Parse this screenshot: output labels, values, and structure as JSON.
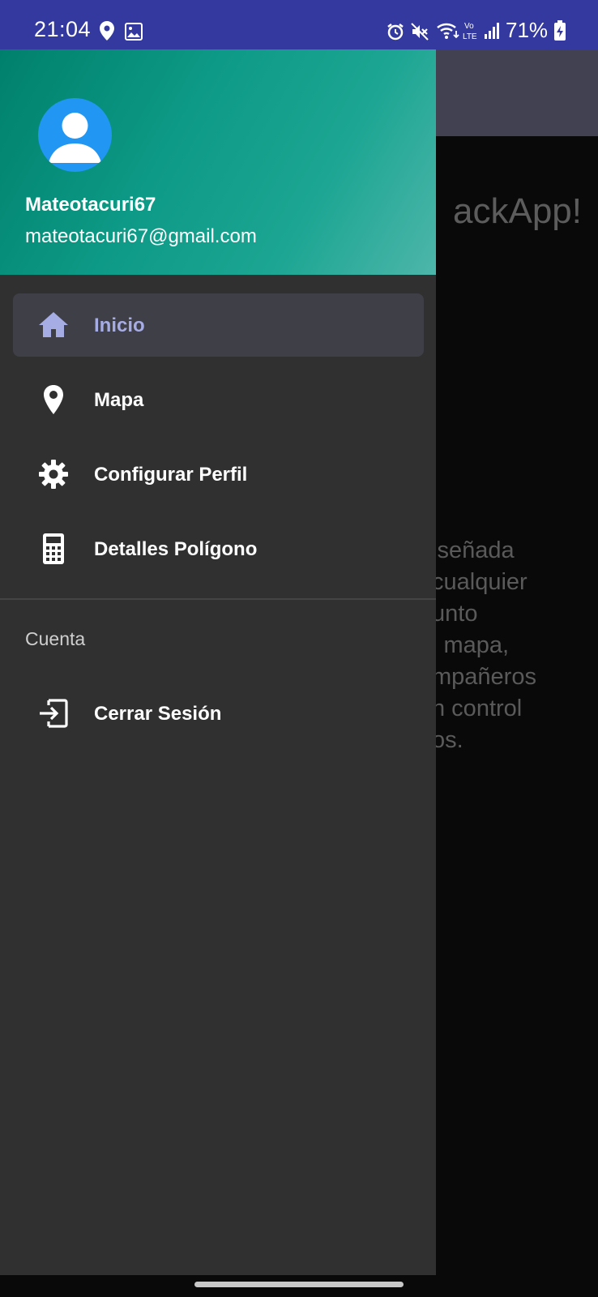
{
  "status_bar": {
    "time": "21:04",
    "battery_percent": "71%",
    "icons_left": [
      "location-icon",
      "image-icon"
    ],
    "icons_right": [
      "alarm-icon",
      "mute-icon",
      "wifi-icon",
      "volte-icon",
      "signal-icon",
      "battery-icon"
    ],
    "background_color": "#3439a0"
  },
  "background_app": {
    "welcome_fragment": "ackApp!",
    "description_fragments": [
      "iseñada",
      "cualquier",
      "unto",
      "l mapa,",
      "mpañeros",
      "n control",
      "os."
    ],
    "toolbar_color": "#424151"
  },
  "drawer": {
    "header": {
      "user_name": "Mateotacuri67",
      "user_email": "mateotacuri67@gmail.com",
      "avatar_icon": "account-circle-icon",
      "gradient_colors": [
        "#00806c",
        "#4db6aa"
      ]
    },
    "menu_items": [
      {
        "label": "Inicio",
        "icon": "home-icon",
        "active": true
      },
      {
        "label": "Mapa",
        "icon": "map-pin-icon",
        "active": false
      },
      {
        "label": "Configurar Perfil",
        "icon": "gear-icon",
        "active": false
      },
      {
        "label": "Detalles Polígono",
        "icon": "calculator-icon",
        "active": false
      }
    ],
    "account_section": {
      "title": "Cuenta",
      "items": [
        {
          "label": "Cerrar Sesión",
          "icon": "logout-icon"
        }
      ]
    },
    "active_color": "#a6ace4"
  }
}
